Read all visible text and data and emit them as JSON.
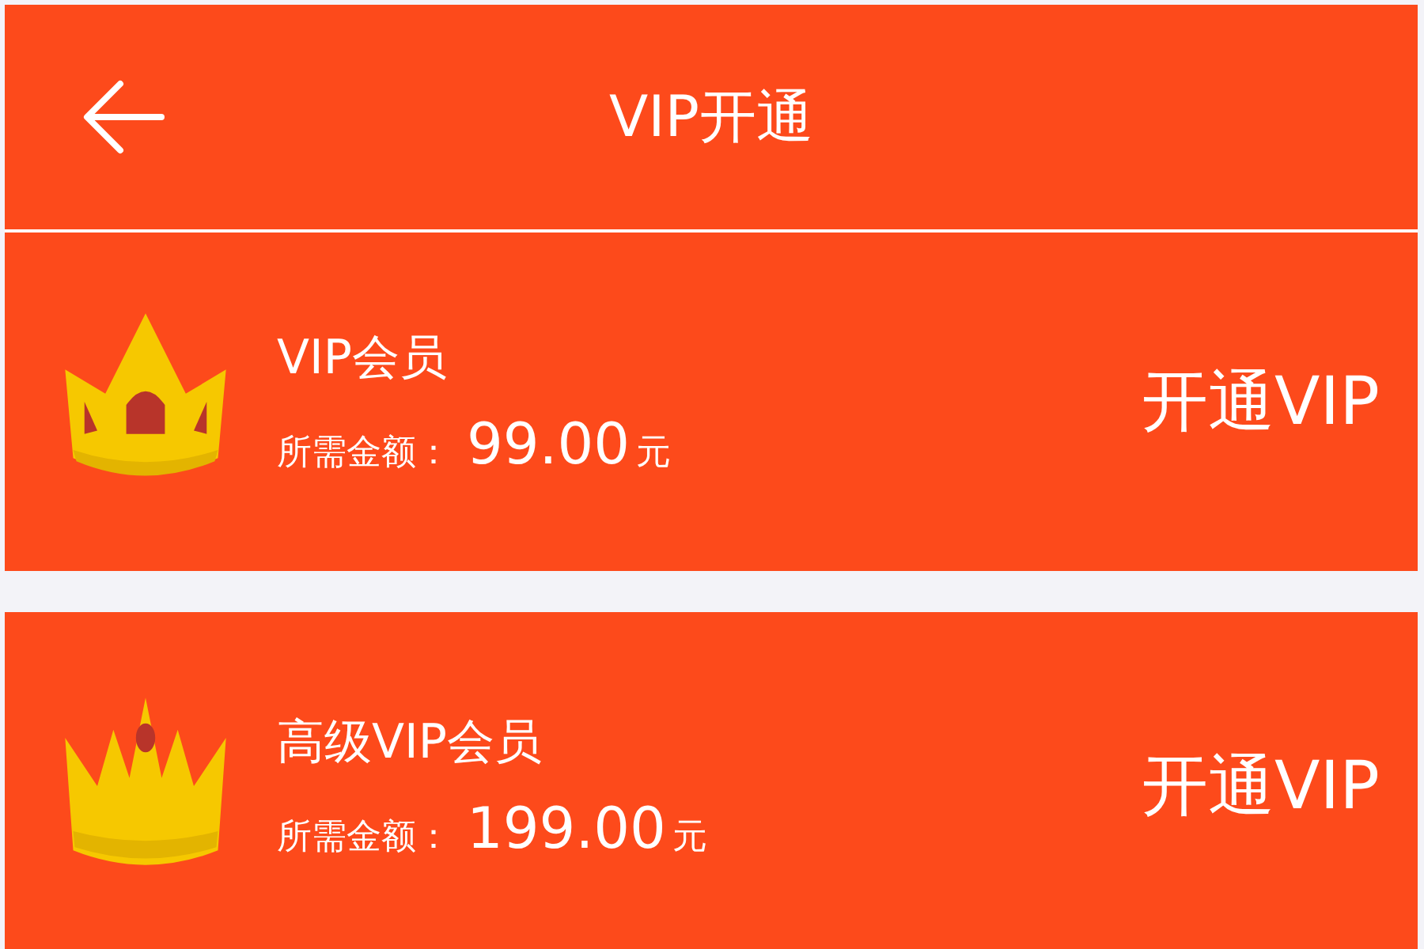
{
  "header": {
    "title": "VIP开通"
  },
  "plans": [
    {
      "kind": "basic",
      "name": "VIP会员",
      "price_label": "所需金额：",
      "price": "99.00",
      "unit": "元",
      "action": "开通VIP"
    },
    {
      "kind": "premium",
      "name": "高级VIP会员",
      "price_label": "所需金额：",
      "price": "199.00",
      "unit": "元",
      "action": "开通VIP"
    }
  ]
}
